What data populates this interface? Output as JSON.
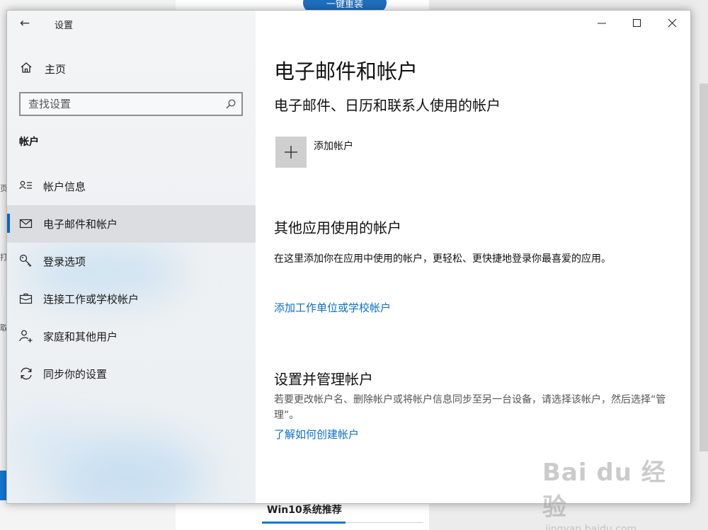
{
  "window": {
    "title": "设置",
    "back_glyph": "←"
  },
  "sidebar": {
    "home_label": "主页",
    "search_placeholder": "查找设置",
    "section_title": "帐户",
    "items": [
      {
        "label": "帐户信息",
        "icon": "account-info-icon",
        "active": false
      },
      {
        "label": "电子邮件和帐户",
        "icon": "mail-icon",
        "active": true
      },
      {
        "label": "登录选项",
        "icon": "key-icon",
        "active": false
      },
      {
        "label": "连接工作或学校帐户",
        "icon": "briefcase-icon",
        "active": false
      },
      {
        "label": "家庭和其他用户",
        "icon": "add-person-icon",
        "active": false
      },
      {
        "label": "同步你的设置",
        "icon": "sync-icon",
        "active": false
      }
    ]
  },
  "content": {
    "page_title": "电子邮件和帐户",
    "section1": {
      "heading": "电子邮件、日历和联系人使用的帐户",
      "add_label": "添加帐户"
    },
    "section2": {
      "heading": "其他应用使用的帐户",
      "description": "在这里添加你在应用中使用的帐户，更轻松、更快捷地登录你最喜爱的应用。",
      "link": "添加工作单位或学校帐户"
    },
    "section3": {
      "heading": "设置并管理帐户",
      "description": "若要更改帐户名、删除帐户或将帐户信息同步至另一台设备，请选择该帐户，然后选择“管理”。",
      "link": "了解如何创建帐户"
    }
  },
  "background": {
    "top_button": "一键重装",
    "edge_texts": [
      "页",
      "打",
      "取"
    ],
    "footer_title": "Win10系统推荐",
    "watermark_main": "Bai du 经验",
    "watermark_sub": "jingyan.baidu.com"
  },
  "colors": {
    "accent": "#0a66c2",
    "link": "#0a6fce",
    "active_bg": "#dcdde0"
  }
}
